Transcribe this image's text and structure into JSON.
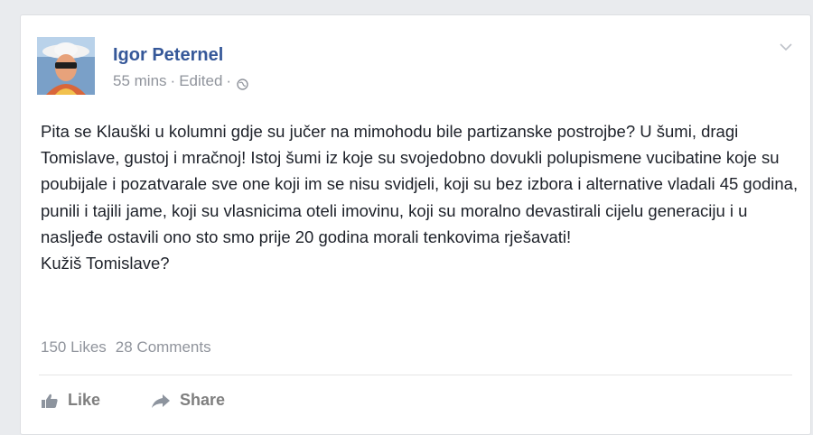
{
  "post": {
    "author": "Igor Peternel",
    "time": "55 mins",
    "edited": "Edited",
    "separator": "·",
    "privacy_icon": "globe-icon",
    "menu_icon": "chevron-down-icon",
    "paragraph": "Pita se Klauški u kolumni gdje su jučer na mimohodu bile partizanske postrojbe? U šumi, dragi Tomislave, gustoj i mračnoj! Istoj šumi iz koje su svojedobno dovukli polupismene vucibatine koje su poubijale i pozatvarale sve one koji im se nisu svidjeli, koji su bez izbora i alternative vladali 45 godina, punili i tajili jame, koji su vlasnicima oteli imovinu, koji su moralno devastirali cijelu generaciju i u nasljeđe ostavili ono sto smo prije 20 godina morali tenkovima rješavati!",
    "closing": "Kužiš Tomislave?",
    "likes": "150 Likes",
    "comments": "28 Comments"
  },
  "actions": {
    "like_label": "Like",
    "like_icon": "thumbs-up-icon",
    "share_label": "Share",
    "share_icon": "share-arrow-icon"
  },
  "colors": {
    "name": "#365899",
    "meta": "#90949c",
    "text": "#1d2129",
    "background": "#e9ebee"
  }
}
